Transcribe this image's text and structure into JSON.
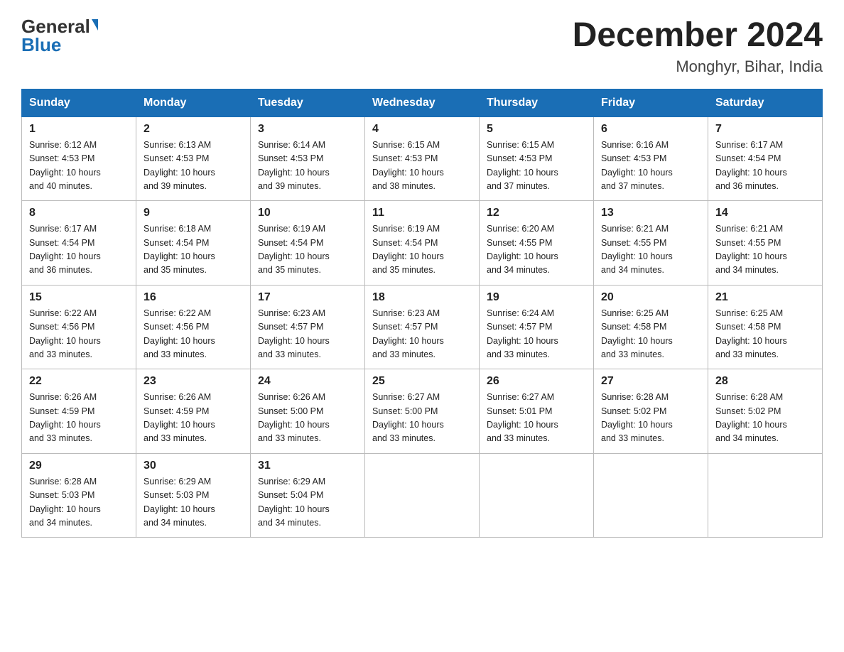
{
  "logo": {
    "general": "General",
    "blue": "Blue"
  },
  "title": {
    "month_year": "December 2024",
    "location": "Monghyr, Bihar, India"
  },
  "headers": [
    "Sunday",
    "Monday",
    "Tuesday",
    "Wednesday",
    "Thursday",
    "Friday",
    "Saturday"
  ],
  "weeks": [
    [
      {
        "day": "1",
        "sunrise": "6:12 AM",
        "sunset": "4:53 PM",
        "daylight": "10 hours and 40 minutes."
      },
      {
        "day": "2",
        "sunrise": "6:13 AM",
        "sunset": "4:53 PM",
        "daylight": "10 hours and 39 minutes."
      },
      {
        "day": "3",
        "sunrise": "6:14 AM",
        "sunset": "4:53 PM",
        "daylight": "10 hours and 39 minutes."
      },
      {
        "day": "4",
        "sunrise": "6:15 AM",
        "sunset": "4:53 PM",
        "daylight": "10 hours and 38 minutes."
      },
      {
        "day": "5",
        "sunrise": "6:15 AM",
        "sunset": "4:53 PM",
        "daylight": "10 hours and 37 minutes."
      },
      {
        "day": "6",
        "sunrise": "6:16 AM",
        "sunset": "4:53 PM",
        "daylight": "10 hours and 37 minutes."
      },
      {
        "day": "7",
        "sunrise": "6:17 AM",
        "sunset": "4:54 PM",
        "daylight": "10 hours and 36 minutes."
      }
    ],
    [
      {
        "day": "8",
        "sunrise": "6:17 AM",
        "sunset": "4:54 PM",
        "daylight": "10 hours and 36 minutes."
      },
      {
        "day": "9",
        "sunrise": "6:18 AM",
        "sunset": "4:54 PM",
        "daylight": "10 hours and 35 minutes."
      },
      {
        "day": "10",
        "sunrise": "6:19 AM",
        "sunset": "4:54 PM",
        "daylight": "10 hours and 35 minutes."
      },
      {
        "day": "11",
        "sunrise": "6:19 AM",
        "sunset": "4:54 PM",
        "daylight": "10 hours and 35 minutes."
      },
      {
        "day": "12",
        "sunrise": "6:20 AM",
        "sunset": "4:55 PM",
        "daylight": "10 hours and 34 minutes."
      },
      {
        "day": "13",
        "sunrise": "6:21 AM",
        "sunset": "4:55 PM",
        "daylight": "10 hours and 34 minutes."
      },
      {
        "day": "14",
        "sunrise": "6:21 AM",
        "sunset": "4:55 PM",
        "daylight": "10 hours and 34 minutes."
      }
    ],
    [
      {
        "day": "15",
        "sunrise": "6:22 AM",
        "sunset": "4:56 PM",
        "daylight": "10 hours and 33 minutes."
      },
      {
        "day": "16",
        "sunrise": "6:22 AM",
        "sunset": "4:56 PM",
        "daylight": "10 hours and 33 minutes."
      },
      {
        "day": "17",
        "sunrise": "6:23 AM",
        "sunset": "4:57 PM",
        "daylight": "10 hours and 33 minutes."
      },
      {
        "day": "18",
        "sunrise": "6:23 AM",
        "sunset": "4:57 PM",
        "daylight": "10 hours and 33 minutes."
      },
      {
        "day": "19",
        "sunrise": "6:24 AM",
        "sunset": "4:57 PM",
        "daylight": "10 hours and 33 minutes."
      },
      {
        "day": "20",
        "sunrise": "6:25 AM",
        "sunset": "4:58 PM",
        "daylight": "10 hours and 33 minutes."
      },
      {
        "day": "21",
        "sunrise": "6:25 AM",
        "sunset": "4:58 PM",
        "daylight": "10 hours and 33 minutes."
      }
    ],
    [
      {
        "day": "22",
        "sunrise": "6:26 AM",
        "sunset": "4:59 PM",
        "daylight": "10 hours and 33 minutes."
      },
      {
        "day": "23",
        "sunrise": "6:26 AM",
        "sunset": "4:59 PM",
        "daylight": "10 hours and 33 minutes."
      },
      {
        "day": "24",
        "sunrise": "6:26 AM",
        "sunset": "5:00 PM",
        "daylight": "10 hours and 33 minutes."
      },
      {
        "day": "25",
        "sunrise": "6:27 AM",
        "sunset": "5:00 PM",
        "daylight": "10 hours and 33 minutes."
      },
      {
        "day": "26",
        "sunrise": "6:27 AM",
        "sunset": "5:01 PM",
        "daylight": "10 hours and 33 minutes."
      },
      {
        "day": "27",
        "sunrise": "6:28 AM",
        "sunset": "5:02 PM",
        "daylight": "10 hours and 33 minutes."
      },
      {
        "day": "28",
        "sunrise": "6:28 AM",
        "sunset": "5:02 PM",
        "daylight": "10 hours and 34 minutes."
      }
    ],
    [
      {
        "day": "29",
        "sunrise": "6:28 AM",
        "sunset": "5:03 PM",
        "daylight": "10 hours and 34 minutes."
      },
      {
        "day": "30",
        "sunrise": "6:29 AM",
        "sunset": "5:03 PM",
        "daylight": "10 hours and 34 minutes."
      },
      {
        "day": "31",
        "sunrise": "6:29 AM",
        "sunset": "5:04 PM",
        "daylight": "10 hours and 34 minutes."
      },
      null,
      null,
      null,
      null
    ]
  ],
  "labels": {
    "sunrise": "Sunrise:",
    "sunset": "Sunset:",
    "daylight": "Daylight:"
  }
}
